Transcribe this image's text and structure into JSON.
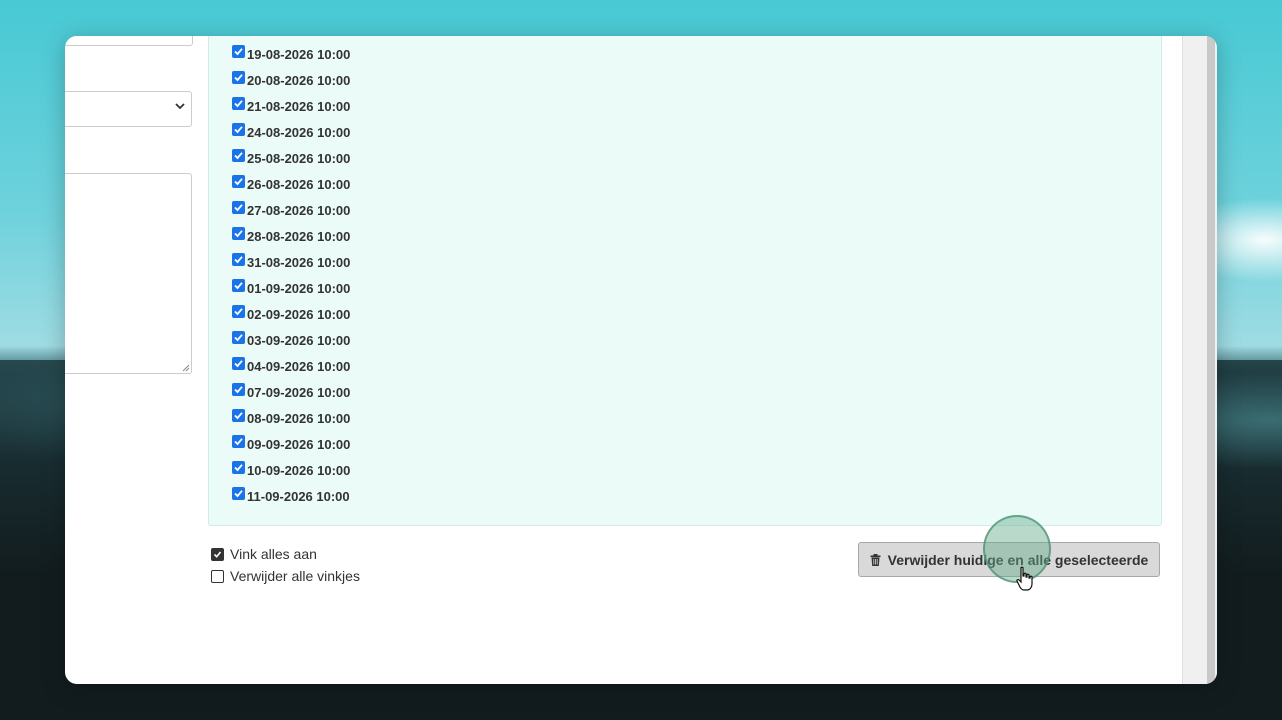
{
  "dates": [
    "19-08-2026 10:00",
    "20-08-2026 10:00",
    "21-08-2026 10:00",
    "24-08-2026 10:00",
    "25-08-2026 10:00",
    "26-08-2026 10:00",
    "27-08-2026 10:00",
    "28-08-2026 10:00",
    "31-08-2026 10:00",
    "01-09-2026 10:00",
    "02-09-2026 10:00",
    "03-09-2026 10:00",
    "04-09-2026 10:00",
    "07-09-2026 10:00",
    "08-09-2026 10:00",
    "09-09-2026 10:00",
    "10-09-2026 10:00",
    "11-09-2026 10:00"
  ],
  "options": {
    "check_all": "Vink alles aan",
    "uncheck_all": "Verwijder alle vinkjes"
  },
  "delete_button": {
    "label": "Verwijder huidige en alle geselecteerde",
    "icon": "trash-icon"
  },
  "colors": {
    "checkbox": "#1a73e8",
    "panel": "#ebfbf8",
    "button": "#d9d9d9"
  }
}
